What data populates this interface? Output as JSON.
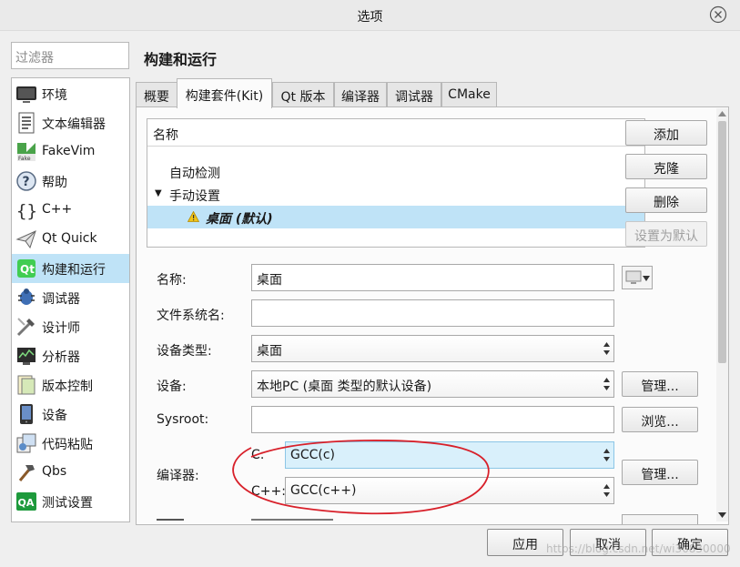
{
  "window": {
    "title": "选项"
  },
  "filter": {
    "placeholder": "过滤器"
  },
  "sidebar": {
    "items": [
      {
        "label": "环境",
        "icon": "monitor-icon"
      },
      {
        "label": "文本编辑器",
        "icon": "text-editor-icon"
      },
      {
        "label": "FakeVim",
        "icon": "fakevim-icon"
      },
      {
        "label": "帮助",
        "icon": "help-icon"
      },
      {
        "label": "C++",
        "icon": "braces-icon"
      },
      {
        "label": "Qt Quick",
        "icon": "paper-plane-icon"
      },
      {
        "label": "构建和运行",
        "icon": "build-run-icon",
        "selected": true
      },
      {
        "label": "调试器",
        "icon": "debugger-icon"
      },
      {
        "label": "设计师",
        "icon": "designer-icon"
      },
      {
        "label": "分析器",
        "icon": "analyzer-icon"
      },
      {
        "label": "版本控制",
        "icon": "version-control-icon"
      },
      {
        "label": "设备",
        "icon": "device-icon"
      },
      {
        "label": "代码粘贴",
        "icon": "code-paste-icon"
      },
      {
        "label": "Qbs",
        "icon": "hammer-icon"
      },
      {
        "label": "测试设置",
        "icon": "qa-icon"
      }
    ]
  },
  "page": {
    "title": "构建和运行"
  },
  "tabs": [
    {
      "label": "概要"
    },
    {
      "label": "构建套件(Kit)",
      "active": true
    },
    {
      "label": "Qt 版本"
    },
    {
      "label": "编译器"
    },
    {
      "label": "调试器"
    },
    {
      "label": "CMake"
    }
  ],
  "kits": {
    "header": "名称",
    "auto": "自动检测",
    "manual": "手动设置",
    "selected_kit": "桌面 (默认)"
  },
  "kit_buttons": {
    "add": "添加",
    "clone": "克隆",
    "remove": "删除",
    "make_default": "设置为默认"
  },
  "form": {
    "name_label": "名称:",
    "name_value": "桌面",
    "fs_name_label": "文件系统名:",
    "fs_name_value": "",
    "device_type_label": "设备类型:",
    "device_type_value": "桌面",
    "device_label": "设备:",
    "device_value": "本地PC (桌面 类型的默认设备)",
    "manage_label": "管理...",
    "sysroot_label": "Sysroot:",
    "sysroot_value": "",
    "browse_label": "浏览...",
    "compiler_label": "编译器:",
    "c_label": "C:",
    "c_value": "GCC(c)",
    "cpp_label": "C++:",
    "cpp_value": "GCC(c++)",
    "compiler_manage_label": "管理..."
  },
  "dialog_buttons": {
    "apply": "应用",
    "cancel": "取消",
    "ok": "确定"
  },
  "watermark": "https://blog.csdn.net/wi36830000",
  "colors": {
    "selection": "#bfe3f7",
    "annotation_red": "#d8202a",
    "warning": "#f0c419"
  }
}
